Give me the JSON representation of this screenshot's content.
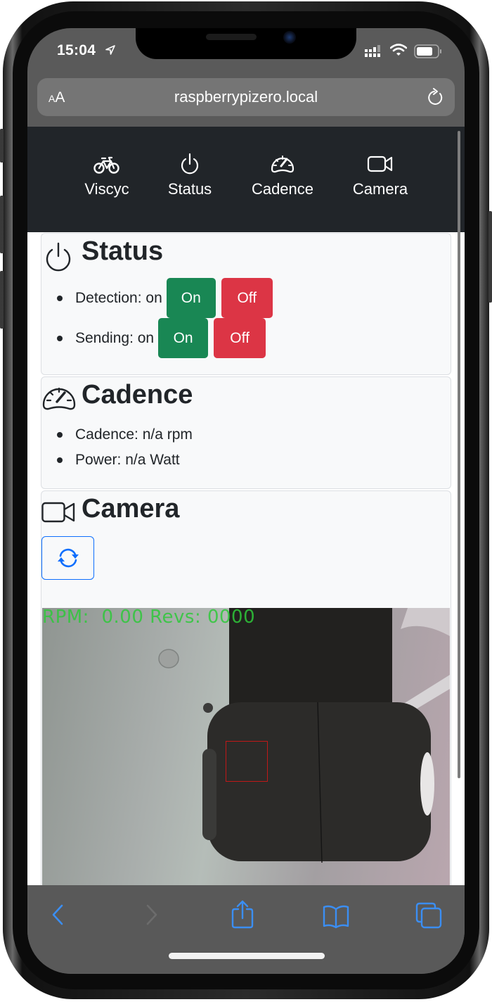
{
  "status_bar": {
    "time": "15:04",
    "location_icon": "location-arrow-icon",
    "signal_icon": "cellular-signal-icon",
    "wifi_icon": "wifi-icon",
    "battery_icon": "battery-icon"
  },
  "browser": {
    "text_size_label_small": "A",
    "text_size_label_large": "A",
    "url": "raspberrypizero.local",
    "reload_icon": "reload-icon"
  },
  "navbar": {
    "items": [
      {
        "label": "Viscyc",
        "icon": "bicycle-icon"
      },
      {
        "label": "Status",
        "icon": "power-icon"
      },
      {
        "label": "Cadence",
        "icon": "speedometer-icon"
      },
      {
        "label": "Camera",
        "icon": "camera-video-icon"
      }
    ]
  },
  "status_card": {
    "title": "Status",
    "icon": "power-icon",
    "items": [
      {
        "label": "Detection: on",
        "on_label": "On",
        "off_label": "Off"
      },
      {
        "label": "Sending: on",
        "on_label": "On",
        "off_label": "Off"
      }
    ]
  },
  "cadence_card": {
    "title": "Cadence",
    "icon": "speedometer-icon",
    "items": [
      {
        "label": "Cadence: n/a rpm"
      },
      {
        "label": "Power: n/a Watt"
      }
    ]
  },
  "camera_card": {
    "title": "Camera",
    "icon": "camera-video-icon",
    "refresh_icon": "refresh-icon",
    "feed_overlay": "RPM:  0.00 Revs: 0000"
  },
  "toolbar": {
    "back_icon": "chevron-left-icon",
    "forward_icon": "chevron-right-icon",
    "share_icon": "share-icon",
    "bookmarks_icon": "book-icon",
    "tabs_icon": "tabs-icon"
  },
  "colors": {
    "navbar_bg": "#212529",
    "success": "#198754",
    "danger": "#dc3545",
    "primary": "#0d6efd",
    "card_bg": "#f8f9fa",
    "overlay_text": "#2ec93a",
    "roi_box": "#c01818",
    "toolbar_tint": "#3b8ef3"
  }
}
